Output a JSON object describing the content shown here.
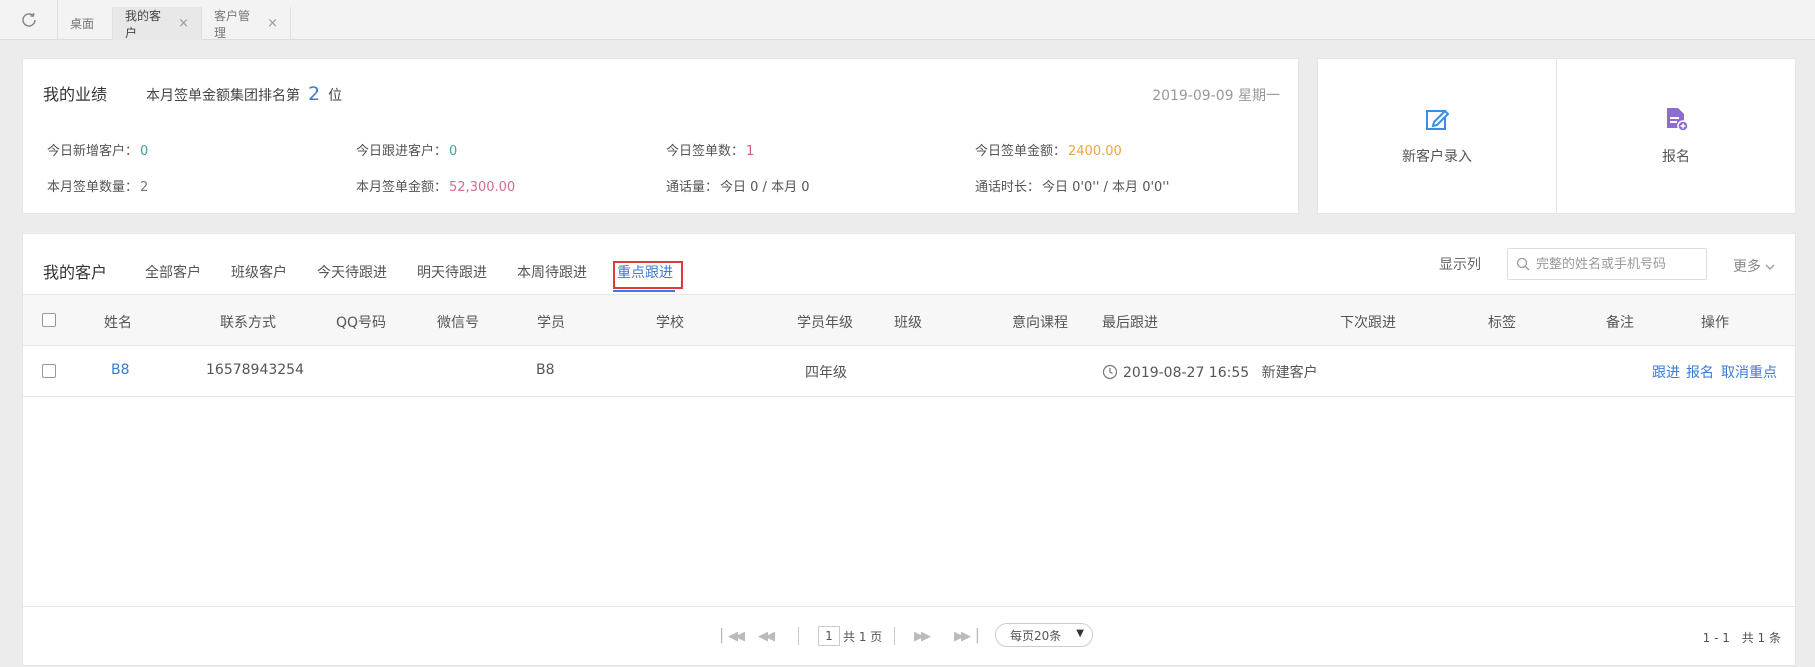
{
  "tabbar": {
    "tabs": [
      {
        "label": "桌面",
        "closable": false
      },
      {
        "label": "我的客户",
        "closable": true
      },
      {
        "label": "客户管理",
        "closable": true
      }
    ],
    "close_glyph": "×"
  },
  "performance": {
    "title": "我的业绩",
    "rank_prefix": "本月签单金额集团排名第",
    "rank_value": "2",
    "rank_suffix": "位",
    "date": "2019-09-09 星期一",
    "stats": {
      "today_new_label": "今日新增客户：",
      "today_new_value": "0",
      "today_follow_label": "今日跟进客户：",
      "today_follow_value": "0",
      "today_orders_label": "今日签单数：",
      "today_orders_value": "1",
      "today_amount_label": "今日签单金额：",
      "today_amount_value": "2400.00",
      "month_orders_label": "本月签单数量：",
      "month_orders_value": "2",
      "month_amount_label": "本月签单金额：",
      "month_amount_value": "52,300.00",
      "calls_label": "通话量：",
      "calls_value": "今日 0 / 本月 0",
      "duration_label": "通话时长：",
      "duration_value": "今日 0'0'' / 本月 0'0''"
    }
  },
  "actions": {
    "new_customer": "新客户录入",
    "enroll": "报名",
    "colors": {
      "edit": "#3a8ee6",
      "enroll": "#8e6bd1"
    }
  },
  "customers": {
    "title": "我的客户",
    "tabs": [
      "全部客户",
      "班级客户",
      "今天待跟进",
      "明天待跟进",
      "本周待跟进",
      "重点跟进"
    ],
    "active_tab": "重点跟进",
    "show_columns": "显示列",
    "search_placeholder": "完整的姓名或手机号码",
    "more": "更多",
    "columns": [
      "姓名",
      "联系方式",
      "QQ号码",
      "微信号",
      "学员",
      "学校",
      "学员年级",
      "班级",
      "意向课程",
      "最后跟进",
      "下次跟进",
      "标签",
      "备注",
      "操作"
    ],
    "rows": [
      {
        "name": "B8",
        "phone": "16578943254",
        "qq": "",
        "wechat": "",
        "student": "B8",
        "school": "",
        "grade": "四年级",
        "class": "",
        "course": "",
        "last_follow_time": "2019-08-27 16:55",
        "last_follow_note": "新建客户",
        "next_follow": "",
        "tag": "",
        "remark": "",
        "ops": [
          "跟进",
          "报名",
          "取消重点"
        ]
      }
    ]
  },
  "pager": {
    "current_page": "1",
    "total_pages": "共 1 页",
    "page_size": "每页20条",
    "range": "1 - 1",
    "total": "共 1 条"
  },
  "theme": {
    "accent": "#3a7bd5",
    "highlight_box": "#e03a3a"
  }
}
